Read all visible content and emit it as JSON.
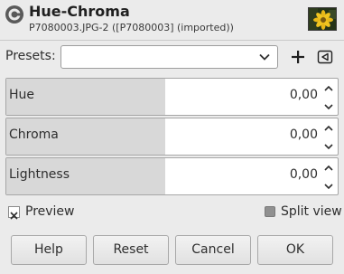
{
  "header": {
    "title": "Hue-Chroma",
    "subtitle": "P7080003.JPG-2 ([P7080003] (imported))",
    "app_icon": "gimp-icon",
    "thumbnail_icon": "image-thumbnail"
  },
  "presets": {
    "label": "Presets:",
    "selected_value": "",
    "add_icon": "plus-icon",
    "menu_icon": "triangle-left-icon"
  },
  "sliders": [
    {
      "label": "Hue",
      "value": "0,00"
    },
    {
      "label": "Chroma",
      "value": "0,00"
    },
    {
      "label": "Lightness",
      "value": "0,00"
    }
  ],
  "preview": {
    "label": "Preview",
    "checked": true
  },
  "split_view": {
    "label": "Split view",
    "checked": false
  },
  "buttons": {
    "help": "Help",
    "reset": "Reset",
    "cancel": "Cancel",
    "ok": "OK"
  },
  "colors": {
    "background": "#ebebeb",
    "slider_fill": "#d8d8d8",
    "field_bg": "#ffffff"
  }
}
